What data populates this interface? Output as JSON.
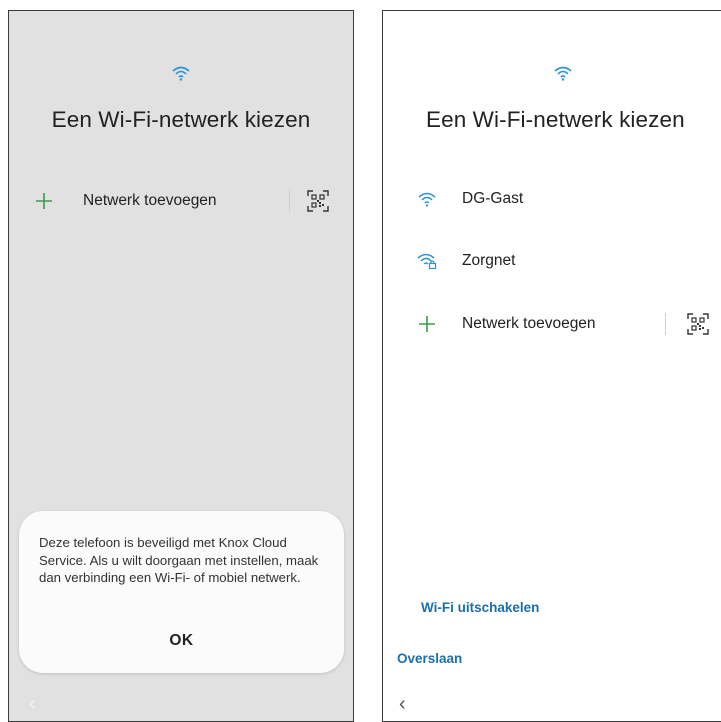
{
  "left_screen": {
    "title": "Een Wi-Fi-netwerk kiezen",
    "add_network_label": "Netwerk toevoegen",
    "dialog": {
      "message": "Deze telefoon is beveiligd met Knox Cloud Service. Als u wilt doorgaan met instellen, maak dan verbinding een Wi-Fi- of mobiel netwerk.",
      "ok_label": "OK"
    },
    "back_glyph": "‹"
  },
  "right_screen": {
    "title": "Een Wi-Fi-netwerk kiezen",
    "networks": [
      {
        "name": "DG-Gast",
        "icon": "wifi-icon"
      },
      {
        "name": "Zorgnet",
        "icon": "wifi-lock-icon"
      }
    ],
    "add_network_label": "Netwerk toevoegen",
    "wifi_off_link": "Wi-Fi uitschakelen",
    "skip_link": "Overslaan",
    "back_glyph": "‹"
  },
  "colors": {
    "accent_blue": "#1a6fb0",
    "wifi_icon": "#2a93d5",
    "add_plus": "#3b9a4e",
    "dimmed_bg": "#e1e1e1"
  }
}
